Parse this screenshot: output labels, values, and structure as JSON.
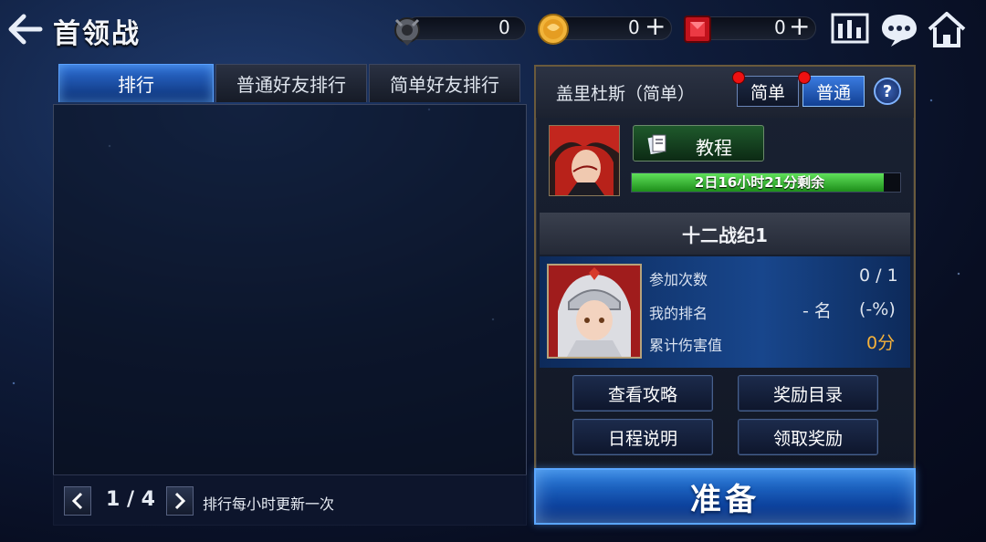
{
  "header": {
    "title": "首领战",
    "currencies": [
      {
        "icon": "emblem-icon",
        "value": "0",
        "has_plus": false
      },
      {
        "icon": "gold-coin-icon",
        "value": "0",
        "has_plus": true
      },
      {
        "icon": "red-gem-icon",
        "value": "0",
        "has_plus": true
      }
    ],
    "plus_label": "+"
  },
  "tabs": [
    {
      "label": "排行",
      "active": true
    },
    {
      "label": "普通好友排行",
      "active": false
    },
    {
      "label": "简单好友排行",
      "active": false
    }
  ],
  "pager": {
    "prev": "<",
    "next": ">",
    "page": "1 / 4",
    "note": "排行每小时更新一次"
  },
  "boss": {
    "name": "盖里杜斯（简单）",
    "difficulty_easy": "简单",
    "difficulty_normal": "普通",
    "help": "?",
    "tutorial_label": "教程",
    "timer_text": "2日16小时21分剩余",
    "timer_progress": 0.94
  },
  "season": {
    "title": "十二战纪1"
  },
  "stats": {
    "participation_label": "参加次数",
    "participation_value": "0 / 1",
    "rank_label": "我的排名",
    "rank_value": "- 名",
    "rank_percent": "(-%)",
    "damage_label": "累计伤害值",
    "damage_value": "0分"
  },
  "actions": {
    "guide": "查看攻略",
    "reward_list": "奖励目录",
    "schedule": "日程说明",
    "claim_reward": "领取奖励"
  },
  "ready_label": "准备",
  "colors": {
    "accent_blue": "#2b80e0",
    "gold": "#f6b23a",
    "timer_green": "#5fe05a",
    "notify_red": "#e11111"
  }
}
